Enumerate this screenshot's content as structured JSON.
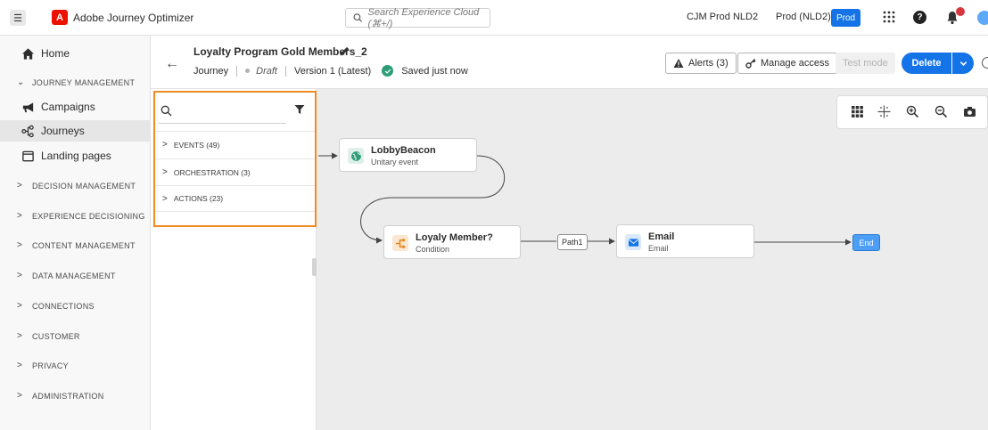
{
  "app": {
    "brand": "Adobe Journey Optimizer",
    "search_placeholder": "Search Experience Cloud (⌘+/)",
    "org": "CJM Prod NLD2",
    "sandbox": "Prod (NLD2)",
    "sandbox_badge": "Prod"
  },
  "sidebar": {
    "home": "Home",
    "journey_section": "JOURNEY MANAGEMENT",
    "items": [
      {
        "label": "Campaigns"
      },
      {
        "label": "Journeys"
      },
      {
        "label": "Landing pages"
      }
    ],
    "sections": [
      "DECISION MANAGEMENT",
      "EXPERIENCE DECISIONING",
      "CONTENT MANAGEMENT",
      "DATA MANAGEMENT",
      "CONNECTIONS",
      "CUSTOMER",
      "PRIVACY",
      "ADMINISTRATION"
    ]
  },
  "journey": {
    "title": "Loyalty Program Gold Members_2",
    "type": "Journey",
    "status": "Draft",
    "version": "Version 1 (Latest)",
    "saved": "Saved just now",
    "alerts_label": "Alerts (3)",
    "manage_access_label": "Manage access",
    "test_mode_label": "Test mode",
    "delete_label": "Delete"
  },
  "palette": {
    "rows": [
      {
        "label": "EVENTS (49)"
      },
      {
        "label": "ORCHESTRATION (3)"
      },
      {
        "label": "ACTIONS (23)"
      }
    ]
  },
  "canvas": {
    "nodes": {
      "event": {
        "title": "LobbyBeacon",
        "subtitle": "Unitary event"
      },
      "condition": {
        "title": "Loyaly Member?",
        "subtitle": "Condition"
      },
      "email": {
        "title": "Email",
        "subtitle": "Email"
      }
    },
    "path_label": "Path1",
    "end_label": "End"
  },
  "colors": {
    "accent": "#1473e6",
    "highlight": "#f08a24",
    "event_icon": "#2d9d78",
    "condition_icon": "#e68619",
    "email_icon": "#1473e6"
  }
}
